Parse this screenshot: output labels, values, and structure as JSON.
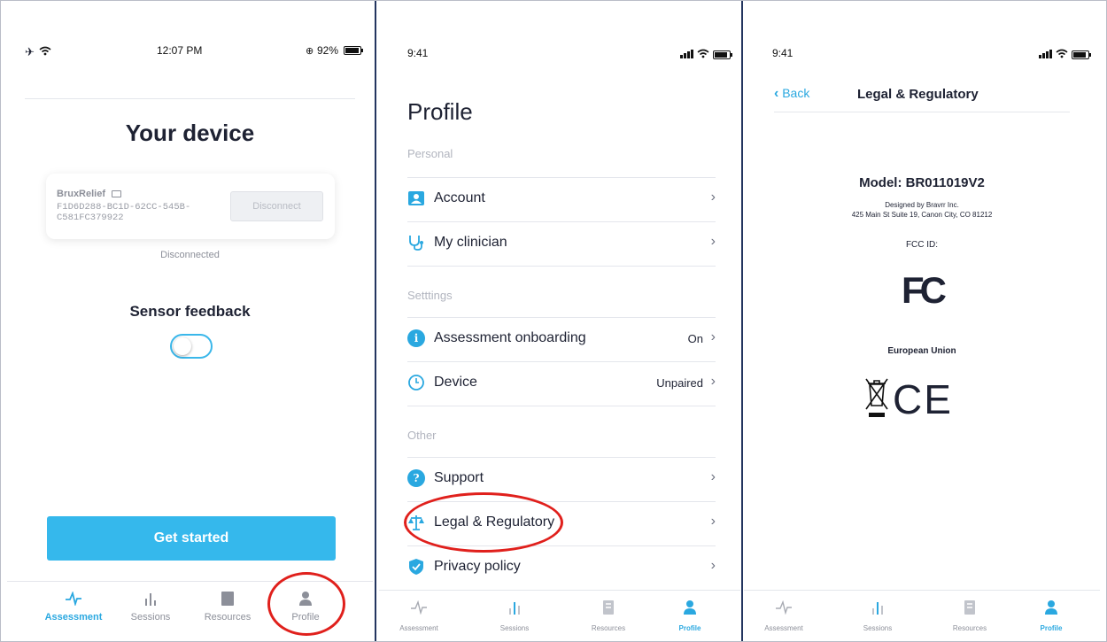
{
  "panel1": {
    "status": {
      "time": "12:07 PM",
      "battery": "92%",
      "battery_level": 0.92
    },
    "title": "Your device",
    "device": {
      "name": "BruxRelief",
      "id": "F1D6D288-BC1D-62CC-545B-C581FC379922",
      "button": "Disconnect"
    },
    "connection_status": "Disconnected",
    "sensor_title": "Sensor feedback",
    "primary_button": "Get started",
    "tabs": [
      {
        "label": "Assessment",
        "icon": "pulse-icon",
        "active": true
      },
      {
        "label": "Sessions",
        "icon": "bar-chart-icon",
        "active": false
      },
      {
        "label": "Resources",
        "icon": "book-icon",
        "active": false
      },
      {
        "label": "Profile",
        "icon": "person-icon",
        "active": false
      }
    ]
  },
  "panel2": {
    "status": {
      "time": "9:41"
    },
    "title": "Profile",
    "sections": [
      {
        "header": "Personal",
        "items": [
          {
            "label": "Account",
            "value": "",
            "icon": "account-icon"
          },
          {
            "label": "My clinician",
            "value": "",
            "icon": "stethoscope-icon"
          }
        ]
      },
      {
        "header": "Setttings",
        "items": [
          {
            "label": "Assessment onboarding",
            "value": "On",
            "icon": "info-icon"
          },
          {
            "label": "Device",
            "value": "Unpaired",
            "icon": "device-icon"
          }
        ]
      },
      {
        "header": "Other",
        "items": [
          {
            "label": "Support",
            "value": "",
            "icon": "help-icon"
          },
          {
            "label": "Legal & Regulatory",
            "value": "",
            "icon": "scales-icon"
          },
          {
            "label": "Privacy policy",
            "value": "",
            "icon": "shield-icon"
          }
        ]
      }
    ],
    "tabs": [
      {
        "label": "Assessment",
        "icon": "pulse-icon",
        "active": false
      },
      {
        "label": "Sessions",
        "icon": "bar-chart-icon",
        "active": false
      },
      {
        "label": "Resources",
        "icon": "book-icon",
        "active": false
      },
      {
        "label": "Profile",
        "icon": "person-icon",
        "active": true
      }
    ]
  },
  "panel3": {
    "status": {
      "time": "9:41"
    },
    "back": "Back",
    "title": "Legal & Regulatory",
    "model": "Model: BR011019V2",
    "designed_by": "Designed by Bravrr Inc.",
    "address": "425 Main St Suite 19, Canon City, CO 81212",
    "fcc_label": "FCC ID:",
    "fcc_logo": "FC",
    "eu_label": "European Union",
    "ce_mark": "CE",
    "tabs": [
      {
        "label": "Assessment",
        "icon": "pulse-icon",
        "active": false
      },
      {
        "label": "Sessions",
        "icon": "bar-chart-icon",
        "active": false
      },
      {
        "label": "Resources",
        "icon": "book-icon",
        "active": false
      },
      {
        "label": "Profile",
        "icon": "person-icon",
        "active": true
      }
    ]
  },
  "colors": {
    "accent": "#35b8ec",
    "annotation": "#e0201c",
    "text": "#1e2233",
    "muted": "#8c8f99"
  }
}
